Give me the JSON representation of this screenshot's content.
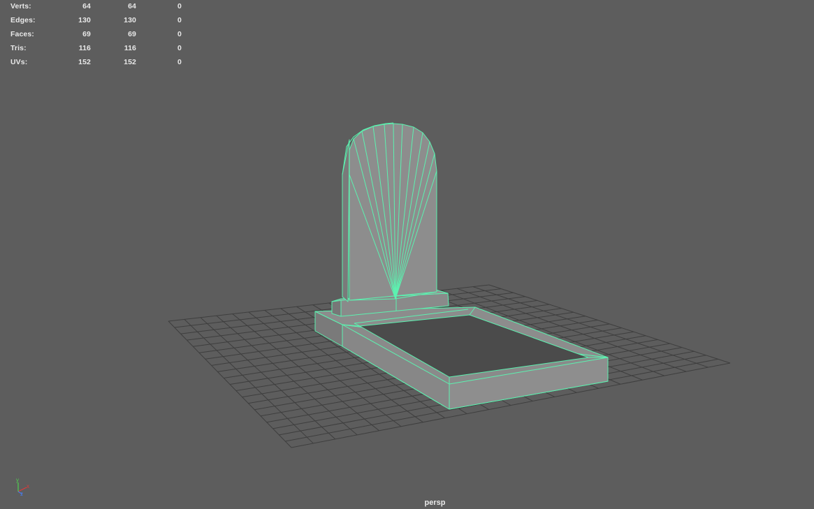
{
  "viewport": {
    "camera_label": "persp",
    "background_color": "#5d5d5d",
    "wireframe_color": "#5cf2b0",
    "grid_color": "#3e3e3e"
  },
  "hud": {
    "rows": [
      {
        "label": "Verts:",
        "col1": "64",
        "col2": "64",
        "col3": "0"
      },
      {
        "label": "Edges:",
        "col1": "130",
        "col2": "130",
        "col3": "0"
      },
      {
        "label": "Faces:",
        "col1": "69",
        "col2": "69",
        "col3": "0"
      },
      {
        "label": "Tris:",
        "col1": "116",
        "col2": "116",
        "col3": "0"
      },
      {
        "label": "UVs:",
        "col1": "152",
        "col2": "152",
        "col3": "0"
      }
    ]
  },
  "axis_gizmo": {
    "x_label": "x",
    "y_label": "y",
    "z_label": "z",
    "x_color": "#e03a3a",
    "y_color": "#4fd04f",
    "z_color": "#4a7ce8"
  }
}
